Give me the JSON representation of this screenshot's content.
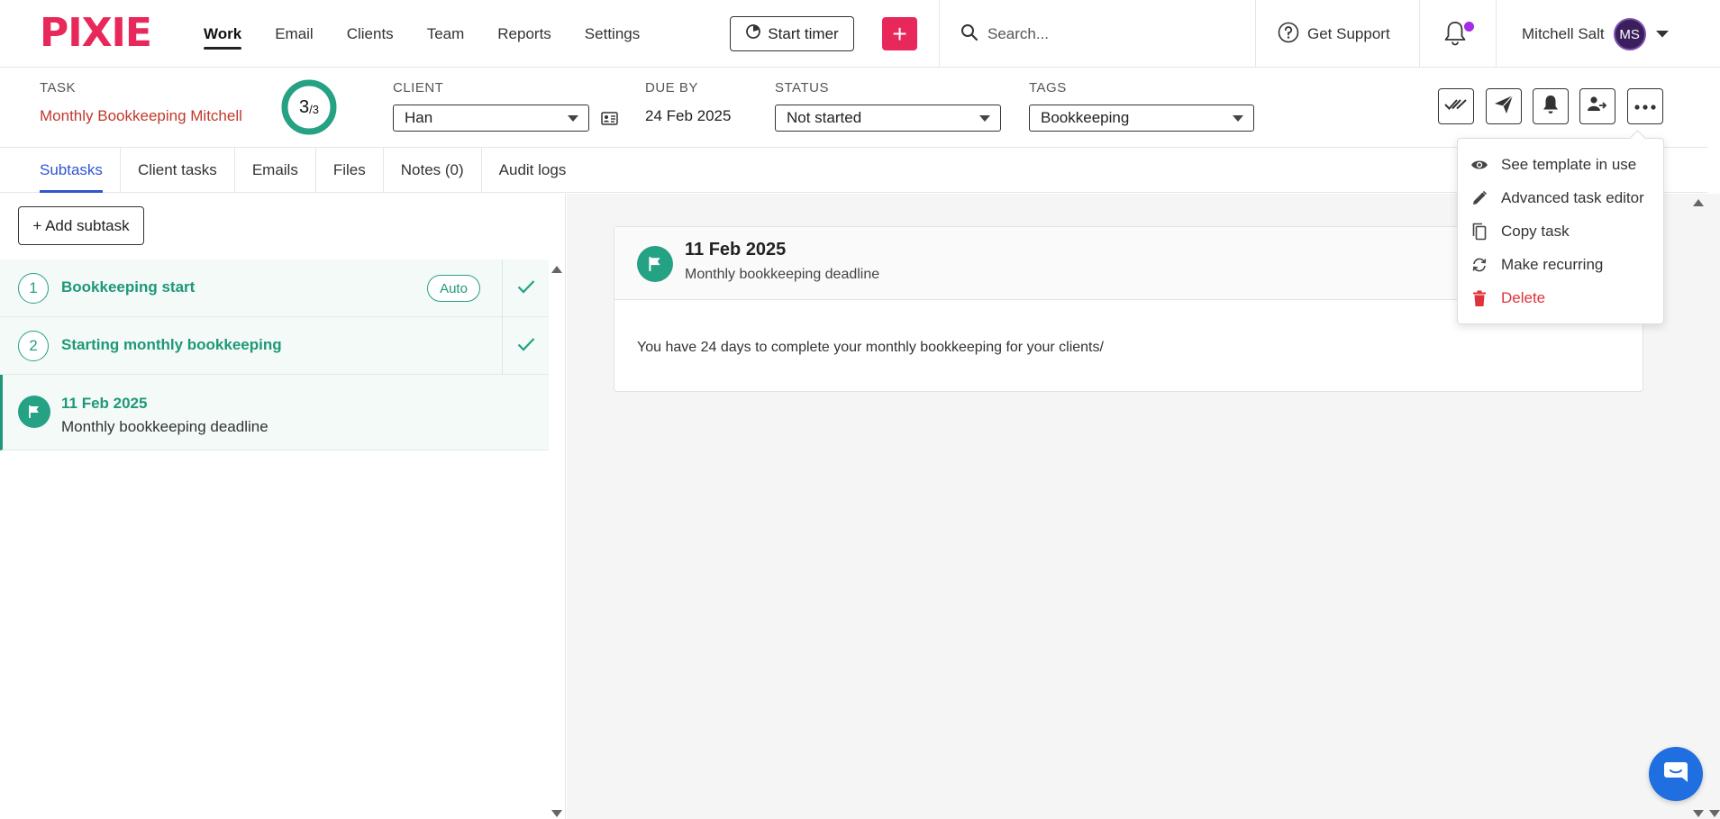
{
  "brand": {
    "logo_text": "PIXIE",
    "accent": "#e8285a"
  },
  "nav": {
    "links": [
      {
        "label": "Work",
        "active": true
      },
      {
        "label": "Email"
      },
      {
        "label": "Clients"
      },
      {
        "label": "Team"
      },
      {
        "label": "Reports"
      },
      {
        "label": "Settings"
      }
    ],
    "timer_label": "Start timer",
    "add_label": "+",
    "search_placeholder": "Search...",
    "support_label": "Get Support",
    "user_name": "Mitchell Salt",
    "user_initials": "MS"
  },
  "task": {
    "task_label": "TASK",
    "task_name": "Monthly Bookkeeping Mitchell",
    "progress_done": "3",
    "progress_total": "/3",
    "progress_fraction": 1.0,
    "client_label": "CLIENT",
    "client_value": "Han",
    "due_label": "DUE BY",
    "due_value": "24 Feb 2025",
    "status_label": "STATUS",
    "status_value": "Not started",
    "tags_label": "TAGS",
    "tags_value": "Bookkeeping"
  },
  "tabs": [
    {
      "label": "Subtasks",
      "active": true
    },
    {
      "label": "Client tasks"
    },
    {
      "label": "Emails"
    },
    {
      "label": "Files"
    },
    {
      "label": "Notes (0)"
    },
    {
      "label": "Audit logs"
    }
  ],
  "subtasks": {
    "add_label": "+ Add subtask",
    "items": [
      {
        "num": "1",
        "title": "Bookkeeping start",
        "badge": "Auto",
        "done": true
      },
      {
        "num": "2",
        "title": "Starting monthly bookkeeping",
        "done": true
      }
    ],
    "milestone": {
      "date": "11 Feb 2025",
      "desc": "Monthly bookkeeping deadline"
    }
  },
  "detail": {
    "date": "11 Feb 2025",
    "desc": "Monthly bookkeeping deadline",
    "body": "You have 24 days to complete your monthly bookkeeping for your clients/"
  },
  "menu": {
    "items": [
      {
        "label": "See template in use",
        "icon": "eye-icon"
      },
      {
        "label": "Advanced task editor",
        "icon": "pencil-icon"
      },
      {
        "label": "Copy task",
        "icon": "copy-icon"
      },
      {
        "label": "Make recurring",
        "icon": "recurring-icon"
      },
      {
        "label": "Delete",
        "icon": "trash-icon",
        "danger": true
      }
    ]
  },
  "colors": {
    "green": "#25a184",
    "blue": "#2f55d4",
    "danger": "#e0323a"
  }
}
